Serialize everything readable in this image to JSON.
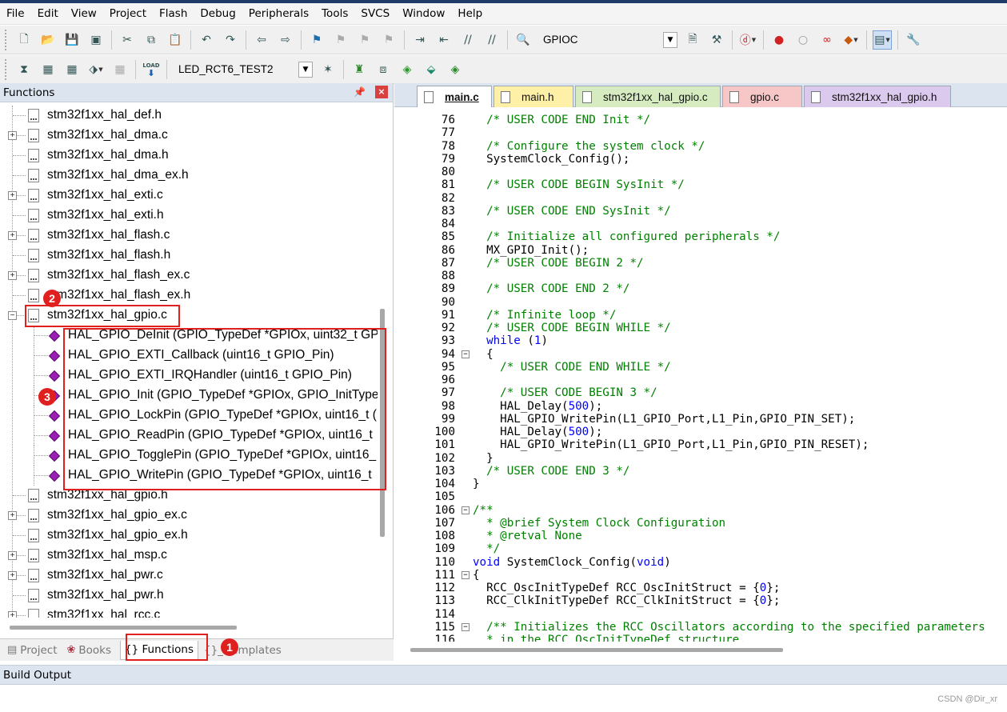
{
  "menu": [
    "File",
    "Edit",
    "View",
    "Project",
    "Flash",
    "Debug",
    "Peripherals",
    "Tools",
    "SVCS",
    "Window",
    "Help"
  ],
  "toolbar1": {
    "find_combo": "GPIOC"
  },
  "toolbar2": {
    "target_combo": "LED_RCT6_TEST2",
    "load_label": "LOAD"
  },
  "left_panel": {
    "title": "Functions",
    "tree": [
      {
        "label": "stm32f1xx_hal_def.h",
        "type": "file",
        "expand": false
      },
      {
        "label": "stm32f1xx_hal_dma.c",
        "type": "file",
        "expand": true
      },
      {
        "label": "stm32f1xx_hal_dma.h",
        "type": "file",
        "expand": false
      },
      {
        "label": "stm32f1xx_hal_dma_ex.h",
        "type": "file",
        "expand": false
      },
      {
        "label": "stm32f1xx_hal_exti.c",
        "type": "file",
        "expand": true
      },
      {
        "label": "stm32f1xx_hal_exti.h",
        "type": "file",
        "expand": false
      },
      {
        "label": "stm32f1xx_hal_flash.c",
        "type": "file",
        "expand": true
      },
      {
        "label": "stm32f1xx_hal_flash.h",
        "type": "file",
        "expand": false
      },
      {
        "label": "stm32f1xx_hal_flash_ex.c",
        "type": "file",
        "expand": true
      },
      {
        "label": "stm32f1xx_hal_flash_ex.h",
        "type": "file",
        "expand": false
      },
      {
        "label": "stm32f1xx_hal_gpio.c",
        "type": "file",
        "expand": "open"
      },
      {
        "label": "HAL_GPIO_DeInit (GPIO_TypeDef *GPIOx, uint32_t GP",
        "type": "fn"
      },
      {
        "label": "HAL_GPIO_EXTI_Callback (uint16_t GPIO_Pin)",
        "type": "fn"
      },
      {
        "label": "HAL_GPIO_EXTI_IRQHandler (uint16_t GPIO_Pin)",
        "type": "fn"
      },
      {
        "label": "HAL_GPIO_Init (GPIO_TypeDef *GPIOx, GPIO_InitType",
        "type": "fn"
      },
      {
        "label": "HAL_GPIO_LockPin (GPIO_TypeDef *GPIOx, uint16_t (",
        "type": "fn"
      },
      {
        "label": "HAL_GPIO_ReadPin (GPIO_TypeDef *GPIOx, uint16_t",
        "type": "fn"
      },
      {
        "label": "HAL_GPIO_TogglePin (GPIO_TypeDef *GPIOx, uint16_",
        "type": "fn"
      },
      {
        "label": "HAL_GPIO_WritePin (GPIO_TypeDef *GPIOx, uint16_t",
        "type": "fn"
      },
      {
        "label": "stm32f1xx_hal_gpio.h",
        "type": "file",
        "expand": false
      },
      {
        "label": "stm32f1xx_hal_gpio_ex.c",
        "type": "file",
        "expand": true
      },
      {
        "label": "stm32f1xx_hal_gpio_ex.h",
        "type": "file",
        "expand": false
      },
      {
        "label": "stm32f1xx_hal_msp.c",
        "type": "file",
        "expand": true
      },
      {
        "label": "stm32f1xx_hal_pwr.c",
        "type": "file",
        "expand": true
      },
      {
        "label": "stm32f1xx_hal_pwr.h",
        "type": "file",
        "expand": false
      },
      {
        "label": "stm32f1xx_hal_rcc.c",
        "type": "file",
        "expand": true
      }
    ],
    "tabs": {
      "project": "Project",
      "books": "Books",
      "functions": "{} Functions",
      "templates": "{}_ Templates"
    }
  },
  "badges": {
    "b1": "1",
    "b2": "2",
    "b3": "3"
  },
  "editor": {
    "tabs": [
      {
        "label": "main.c",
        "color": "#ffffff",
        "active": true
      },
      {
        "label": "main.h",
        "color": "#fff0a8"
      },
      {
        "label": "stm32f1xx_hal_gpio.c",
        "color": "#d6ecc0"
      },
      {
        "label": "gpio.c",
        "color": "#f7c7c7"
      },
      {
        "label": "stm32f1xx_hal_gpio.h",
        "color": "#dcc9ee"
      }
    ],
    "lines": [
      {
        "n": "76",
        "t": "  /* USER CODE END Init */",
        "c": "cm"
      },
      {
        "n": "77",
        "t": ""
      },
      {
        "n": "78",
        "t": "  /* Configure the system clock */",
        "c": "cm"
      },
      {
        "n": "79",
        "t": "  SystemClock_Config();"
      },
      {
        "n": "80",
        "t": ""
      },
      {
        "n": "81",
        "t": "  /* USER CODE BEGIN SysInit */",
        "c": "cm"
      },
      {
        "n": "82",
        "t": ""
      },
      {
        "n": "83",
        "t": "  /* USER CODE END SysInit */",
        "c": "cm"
      },
      {
        "n": "84",
        "t": ""
      },
      {
        "n": "85",
        "t": "  /* Initialize all configured peripherals */",
        "c": "cm"
      },
      {
        "n": "86",
        "t": "  MX_GPIO_Init();"
      },
      {
        "n": "87",
        "t": "  /* USER CODE BEGIN 2 */",
        "c": "cm"
      },
      {
        "n": "88",
        "t": ""
      },
      {
        "n": "89",
        "t": "  /* USER CODE END 2 */",
        "c": "cm"
      },
      {
        "n": "90",
        "t": ""
      },
      {
        "n": "91",
        "t": "  /* Infinite loop */",
        "c": "cm"
      },
      {
        "n": "92",
        "t": "  /* USER CODE BEGIN WHILE */",
        "c": "cm"
      },
      {
        "n": "93",
        "t": "  while (1)",
        "kw": "while",
        "num": "1"
      },
      {
        "n": "94",
        "t": "  {",
        "fold": "minus"
      },
      {
        "n": "95",
        "t": "    /* USER CODE END WHILE */",
        "c": "cm"
      },
      {
        "n": "96",
        "t": ""
      },
      {
        "n": "97",
        "t": "    /* USER CODE BEGIN 3 */",
        "c": "cm"
      },
      {
        "n": "98",
        "t": "    HAL_Delay(500);",
        "num": "500"
      },
      {
        "n": "99",
        "t": "    HAL_GPIO_WritePin(L1_GPIO_Port,L1_Pin,GPIO_PIN_SET);"
      },
      {
        "n": "100",
        "t": "    HAL_Delay(500);",
        "num": "500"
      },
      {
        "n": "101",
        "t": "    HAL_GPIO_WritePin(L1_GPIO_Port,L1_Pin,GPIO_PIN_RESET);"
      },
      {
        "n": "102",
        "t": "  }"
      },
      {
        "n": "103",
        "t": "  /* USER CODE END 3 */",
        "c": "cm"
      },
      {
        "n": "104",
        "t": "}"
      },
      {
        "n": "105",
        "t": ""
      },
      {
        "n": "106",
        "t": "/**",
        "c": "cm",
        "fold": "minus"
      },
      {
        "n": "107",
        "t": "  * @brief System Clock Configuration",
        "c": "cm"
      },
      {
        "n": "108",
        "t": "  * @retval None",
        "c": "cm"
      },
      {
        "n": "109",
        "t": "  */",
        "c": "cm"
      },
      {
        "n": "110",
        "t": "void SystemClock_Config(void)",
        "kw": "void"
      },
      {
        "n": "111",
        "t": "{",
        "fold": "minus"
      },
      {
        "n": "112",
        "t": "  RCC_OscInitTypeDef RCC_OscInitStruct = {0};",
        "num": "0"
      },
      {
        "n": "113",
        "t": "  RCC_ClkInitTypeDef RCC_ClkInitStruct = {0};",
        "num": "0"
      },
      {
        "n": "114",
        "t": ""
      },
      {
        "n": "115",
        "t": "  /** Initializes the RCC Oscillators according to the specified parameters",
        "c": "cm",
        "fold": "minus"
      },
      {
        "n": "116",
        "t": "  * in the RCC_OscInitTypeDef structure.",
        "c": "cm"
      }
    ]
  },
  "build_output": {
    "title": "Build Output"
  },
  "watermark": "CSDN @Dir_xr"
}
